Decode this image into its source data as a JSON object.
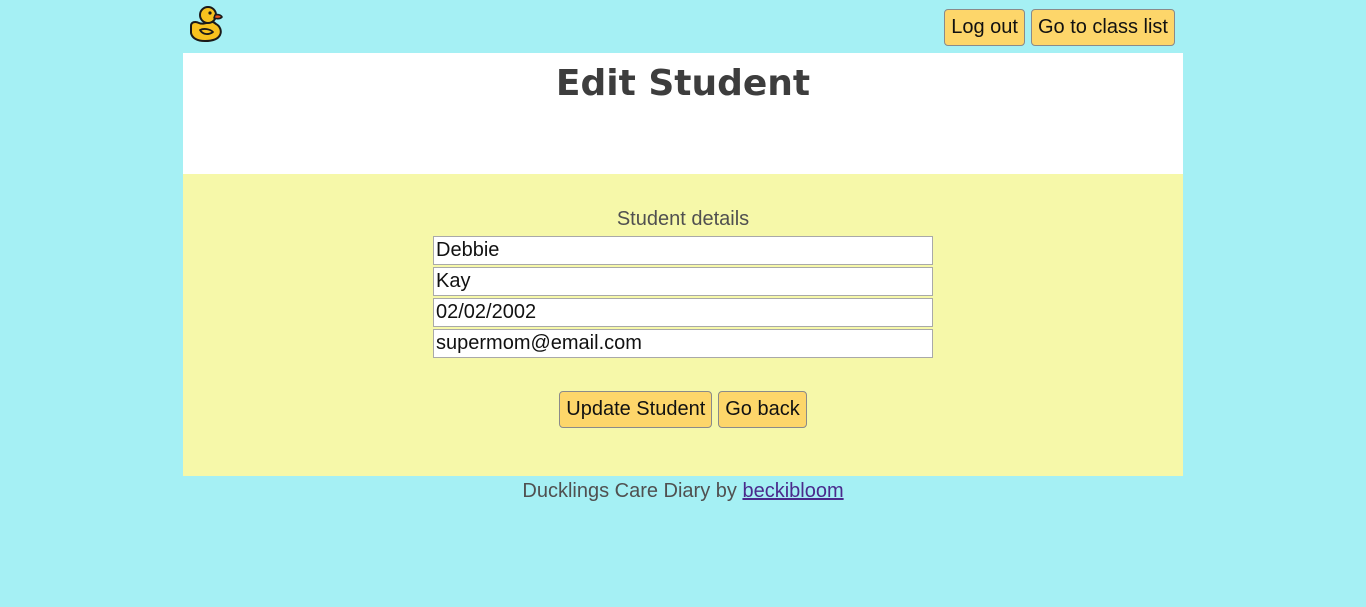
{
  "header": {
    "logo_icon": "rubber-duck-icon",
    "logout_label": "Log out",
    "class_list_label": "Go to class list"
  },
  "main": {
    "title": "Edit Student",
    "form": {
      "legend": "Student details",
      "first_name": "Debbie",
      "last_name": "Kay",
      "date_of_birth": "02/02/2002",
      "email": "supermom@email.com",
      "update_label": "Update Student",
      "back_label": "Go back"
    }
  },
  "footer": {
    "text": "Ducklings Care Diary by",
    "author_link": "beckibloom"
  },
  "colors": {
    "background": "#a5f0f4",
    "card": "#ffffff",
    "form_background": "#f6f8a9",
    "button": "#fdd66a",
    "title_text": "#3d3d3d",
    "link": "#4a2a8c"
  }
}
